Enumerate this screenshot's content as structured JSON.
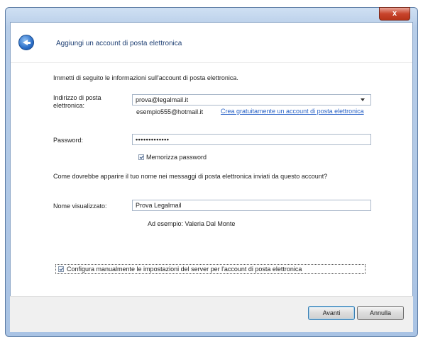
{
  "dialog": {
    "title": "Aggiungi un account di posta elettronica",
    "close_label": "x"
  },
  "form": {
    "intro": "Immetti di seguito le informazioni sull'account di posta elettronica.",
    "email_label": "Indirizzo di posta elettronica:",
    "email_value": "prova@legalmail.it",
    "email_example": "esempio555@hotmail.it",
    "create_account_link": "Crea gratuitamente un account di posta elettronica",
    "password_label": "Password:",
    "password_value": "•••••••••••••",
    "remember_password_label": "Memorizza password",
    "remember_password_checked": true,
    "display_name_question": "Come dovrebbe apparire il tuo nome nei messaggi di posta elettronica inviati da questo account?",
    "display_name_label": "Nome visualizzato:",
    "display_name_value": "Prova Legalmail",
    "display_name_example": "Ad esempio: Valeria Dal Monte",
    "manual_config_label": "Configura manualmente le impostazioni del server per l'account di posta elettronica",
    "manual_config_checked": true
  },
  "footer": {
    "next_label": "Avanti",
    "cancel_label": "Annulla"
  }
}
